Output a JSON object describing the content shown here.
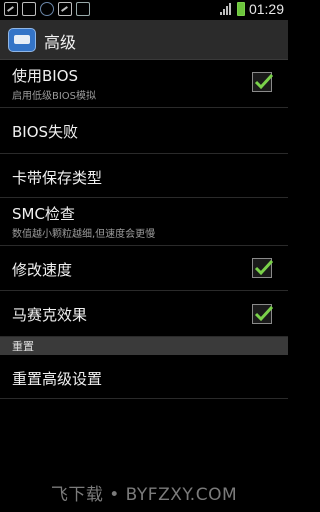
{
  "status_bar": {
    "time": "01:29",
    "icons": [
      "photo-icon",
      "usb-icon",
      "sync-icon",
      "photo-icon",
      "usb-icon",
      "signal-icon",
      "battery-icon"
    ],
    "battery_color": "#6cc43c"
  },
  "action_bar": {
    "title": "高级",
    "icon": "app-icon"
  },
  "settings": [
    {
      "label": "使用BIOS",
      "sub": "启用低级BIOS模拟",
      "checked": true
    },
    {
      "label": "BIOS失败",
      "sub": ""
    },
    {
      "label": "卡带保存类型",
      "sub": ""
    },
    {
      "label": "SMC检查",
      "sub": "数值越小颗粒越细,但速度会更慢"
    },
    {
      "label": "修改速度",
      "sub": "",
      "checked": true
    },
    {
      "label": "马赛克效果",
      "sub": "",
      "checked": true
    }
  ],
  "section_reset": {
    "label": "重置"
  },
  "reset_item": {
    "label": "重置高级设置"
  },
  "watermark": "飞下载 • BYFZXY.COM",
  "colors": {
    "check": "#7ad14a",
    "section_bg": "#3a3a3a",
    "action_bar_bg": "#2b2b2b"
  }
}
